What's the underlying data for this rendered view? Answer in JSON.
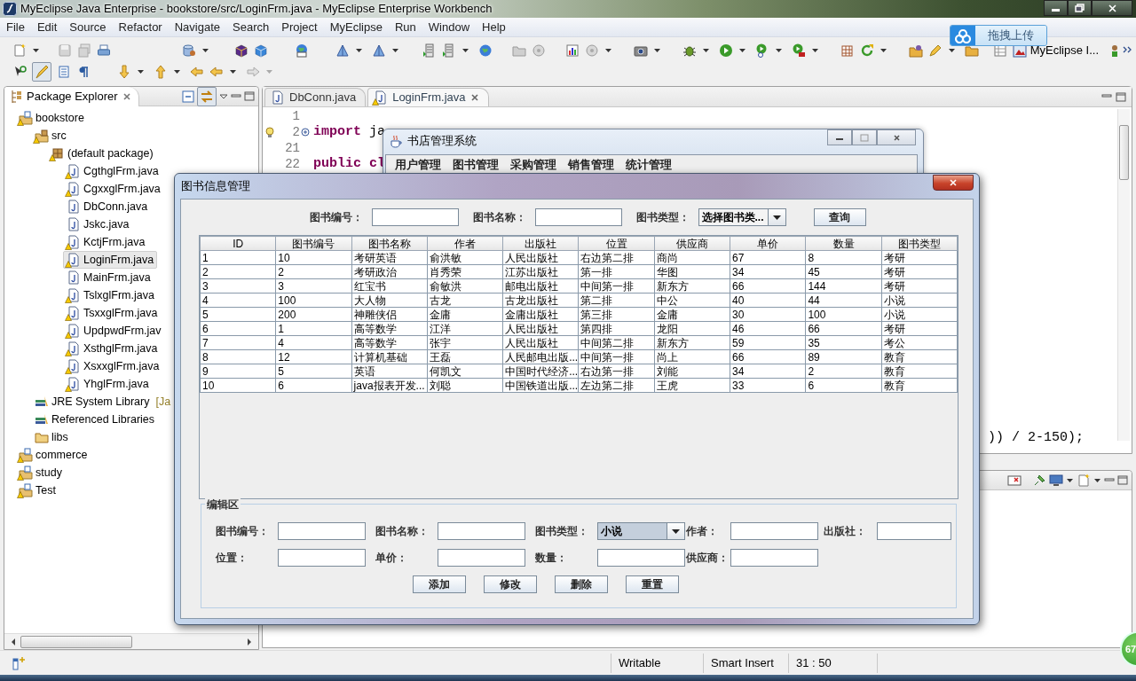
{
  "window": {
    "title": "MyEclipse Java Enterprise - bookstore/src/LoginFrm.java - MyEclipse Enterprise Workbench"
  },
  "menu": [
    "File",
    "Edit",
    "Source",
    "Refactor",
    "Navigate",
    "Search",
    "Project",
    "MyEclipse",
    "Run",
    "Window",
    "Help"
  ],
  "upload_popup": {
    "label": "拖拽上传"
  },
  "toolbar": {
    "highlight_pressed": true,
    "perspective": "MyEclipse I..."
  },
  "package_explorer": {
    "title": "Package Explorer",
    "link_pressed": true,
    "tree": [
      {
        "label": "bookstore",
        "kind": "project",
        "warning": true,
        "selected": false,
        "children": [
          {
            "label": "src",
            "kind": "source-folder",
            "warning": true,
            "selected": false,
            "children": [
              {
                "label": "(default package)",
                "kind": "package",
                "warning": true,
                "selected": false,
                "children": [
                  {
                    "label": "CgthglFrm.java",
                    "kind": "file",
                    "warning": true,
                    "selected": false
                  },
                  {
                    "label": "CgxxglFrm.java",
                    "kind": "file",
                    "warning": true,
                    "selected": false
                  },
                  {
                    "label": "DbConn.java",
                    "kind": "file",
                    "warning": false,
                    "selected": false
                  },
                  {
                    "label": "Jskc.java",
                    "kind": "file",
                    "warning": false,
                    "selected": false
                  },
                  {
                    "label": "KctjFrm.java",
                    "kind": "file",
                    "warning": true,
                    "selected": false
                  },
                  {
                    "label": "LoginFrm.java",
                    "kind": "file",
                    "warning": true,
                    "selected": true
                  },
                  {
                    "label": "MainFrm.java",
                    "kind": "file",
                    "warning": false,
                    "selected": false
                  },
                  {
                    "label": "TslxglFrm.java",
                    "kind": "file",
                    "warning": true,
                    "selected": false
                  },
                  {
                    "label": "TsxxglFrm.java",
                    "kind": "file",
                    "warning": true,
                    "selected": false
                  },
                  {
                    "label": "UpdpwdFrm.jav",
                    "kind": "file",
                    "warning": true,
                    "selected": false
                  },
                  {
                    "label": "XsthglFrm.java",
                    "kind": "file",
                    "warning": true,
                    "selected": false
                  },
                  {
                    "label": "XsxxglFrm.java",
                    "kind": "file",
                    "warning": true,
                    "selected": false
                  },
                  {
                    "label": "YhglFrm.java",
                    "kind": "file",
                    "warning": true,
                    "selected": false
                  }
                ]
              }
            ]
          },
          {
            "label": "JRE System Library",
            "decoration": "[Ja",
            "kind": "library",
            "warning": false,
            "selected": false
          },
          {
            "label": "Referenced Libraries",
            "kind": "library",
            "warning": false,
            "selected": false
          },
          {
            "label": "libs",
            "kind": "folder",
            "warning": false,
            "selected": false
          }
        ]
      },
      {
        "label": "commerce",
        "kind": "project",
        "warning": true,
        "selected": false
      },
      {
        "label": "study",
        "kind": "project",
        "warning": true,
        "selected": false
      },
      {
        "label": "Test",
        "kind": "project",
        "warning": true,
        "selected": false
      }
    ]
  },
  "editor": {
    "tabs": [
      {
        "label": "DbConn.java",
        "warning": false,
        "selected": false
      },
      {
        "label": "LoginFrm.java",
        "warning": true,
        "selected": true
      }
    ],
    "lines": [
      {
        "number": "1",
        "warning": false,
        "folded": false
      },
      {
        "number": "2",
        "warning": true,
        "folded": true,
        "tokens": [
          {
            "text": "import",
            "kind": "keyword"
          },
          {
            "text": "ja",
            "kind": "plain"
          }
        ]
      },
      {
        "number": "21",
        "warning": false,
        "folded": false
      },
      {
        "number": "22",
        "warning": false,
        "folded": false,
        "tokens": [
          {
            "text": "public",
            "kind": "keyword"
          },
          {
            "text": "cl",
            "kind": "keyword"
          }
        ]
      }
    ],
    "fragment": ")) / 2-150);"
  },
  "status_bar": [
    "Writable",
    "Smart Insert",
    "31 : 50"
  ],
  "speed_badge": "67",
  "app_window": {
    "title": "书店管理系统",
    "menu": [
      "用户管理",
      "图书管理",
      "采购管理",
      "销售管理",
      "统计管理"
    ]
  },
  "dialog": {
    "title": "图书信息管理",
    "search": {
      "fields": [
        {
          "label": "图书编号：",
          "kind": "text"
        },
        {
          "label": "图书名称：",
          "kind": "text"
        },
        {
          "label": "图书类型：",
          "kind": "combo",
          "value": "选择图书类...",
          "focused": false
        }
      ],
      "button": "查询"
    },
    "table": {
      "columns": [
        "ID",
        "图书编号",
        "图书名称",
        "作者",
        "出版社",
        "位置",
        "供应商",
        "单价",
        "数量",
        "图书类型"
      ],
      "rows": [
        [
          "1",
          "10",
          "考研英语",
          "俞洪敏",
          "人民出版社",
          "右边第二排",
          "商尚",
          "67",
          "8",
          "考研"
        ],
        [
          "2",
          "2",
          "考研政治",
          "肖秀荣",
          "江苏出版社",
          "第一排",
          "华图",
          "34",
          "45",
          "考研"
        ],
        [
          "3",
          "3",
          "红宝书",
          "俞敏洪",
          "邮电出版社",
          "中间第一排",
          "新东方",
          "66",
          "144",
          "考研"
        ],
        [
          "4",
          "100",
          "大人物",
          "古龙",
          "古龙出版社",
          "第二排",
          "中公",
          "40",
          "44",
          "小说"
        ],
        [
          "5",
          "200",
          "神雕侠侣",
          "金庸",
          "金庸出版社",
          "第三排",
          "金庸",
          "30",
          "100",
          "小说"
        ],
        [
          "6",
          "1",
          "高等数学",
          "江洋",
          "人民出版社",
          "第四排",
          "龙阳",
          "46",
          "66",
          "考研"
        ],
        [
          "7",
          "4",
          "高等数学",
          "张宇",
          "人民出版社",
          "中间第二排",
          "新东方",
          "59",
          "35",
          "考公"
        ],
        [
          "8",
          "12",
          "计算机基础",
          "王磊",
          "人民邮电出版...",
          "中间第一排",
          "尚上",
          "66",
          "89",
          "教育"
        ],
        [
          "9",
          "5",
          "英语",
          "何凯文",
          "中国时代经济...",
          "右边第一排",
          "刘能",
          "34",
          "2",
          "教育"
        ],
        [
          "10",
          "6",
          "java报表开发...",
          "刘聪",
          "中国铁道出版...",
          "左边第二排",
          "王虎",
          "33",
          "6",
          "教育"
        ]
      ]
    },
    "edit_area": {
      "legend": "编辑区",
      "fields": [
        {
          "label": "图书编号：",
          "kind": "text"
        },
        {
          "label": "图书名称：",
          "kind": "text"
        },
        {
          "label": "图书类型：",
          "kind": "combo",
          "value": "小说",
          "focused": true
        },
        {
          "label": "作者：",
          "kind": "text"
        },
        {
          "label": "出版社：",
          "kind": "text"
        },
        {
          "label": "位置：",
          "kind": "text"
        },
        {
          "label": "单价：",
          "kind": "text"
        },
        {
          "label": "数量：",
          "kind": "text"
        },
        {
          "label": "供应商：",
          "kind": "text"
        }
      ],
      "buttons": [
        "添加",
        "修改",
        "删除",
        "重置"
      ]
    }
  }
}
